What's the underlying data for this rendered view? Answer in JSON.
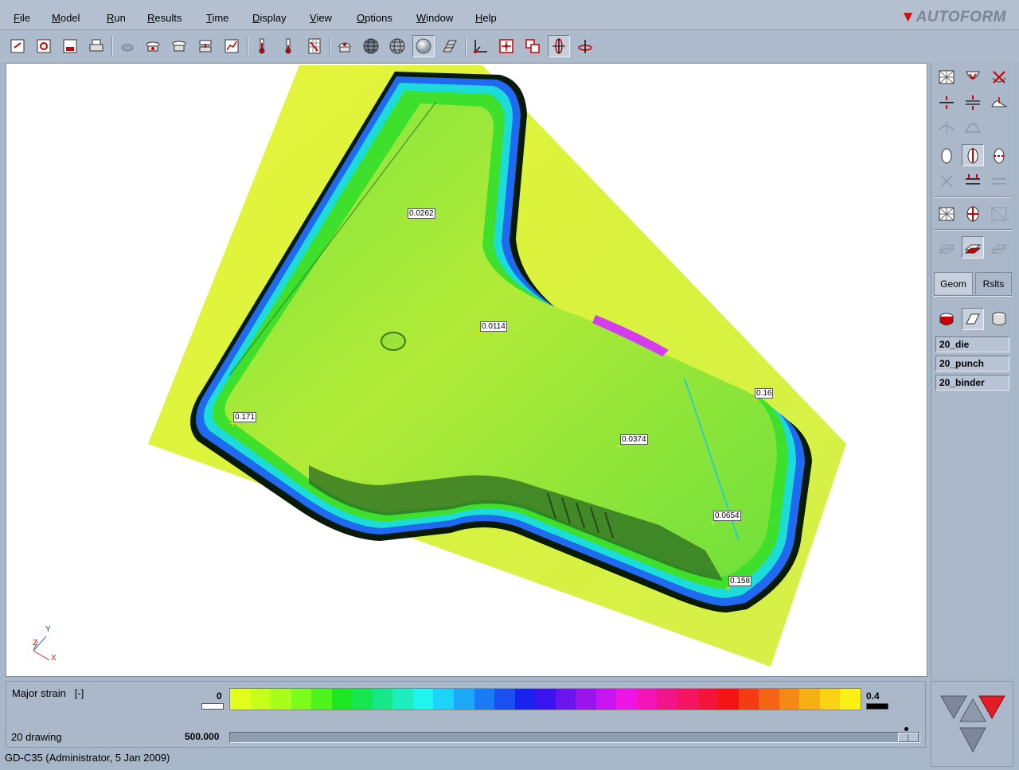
{
  "menu": {
    "items": [
      "File",
      "Model",
      "Run",
      "Results",
      "Time",
      "Display",
      "View",
      "Options",
      "Window",
      "Help"
    ],
    "brand": "AUTOFORM"
  },
  "toolbar": {
    "icons": [
      "open-file-icon",
      "reload-file-icon",
      "save-file-icon",
      "print-icon",
      "blank-icon",
      "tool-setup-icon",
      "blankholder-icon",
      "trim-icon",
      "stage-curve-icon",
      "thermometer-icon",
      "thermometer-alt-icon",
      "grid-chart-icon",
      "eye-view-icon",
      "wire-sphere-icon",
      "mesh-sphere-icon",
      "shaded-sphere-icon",
      "section-cut-icon",
      "axes-icon",
      "fit-view-icon",
      "copy-view-icon",
      "rotate-view-icon",
      "tilt-view-icon"
    ]
  },
  "viewport": {
    "probes": [
      {
        "value": "0.0262"
      },
      {
        "value": "0.0114"
      },
      {
        "value": "0.16"
      },
      {
        "value": "0.171"
      },
      {
        "value": "0.0374"
      },
      {
        "value": "0.0654"
      },
      {
        "value": "0.158"
      }
    ],
    "triad": {
      "x": "X",
      "y": "Y",
      "z": "Z"
    }
  },
  "right_panel": {
    "tabs": {
      "geometry": "Geom",
      "results": "Rslts"
    },
    "tools": [
      "20_die",
      "20_punch",
      "20_binder"
    ]
  },
  "legend": {
    "result_name": "Major strain",
    "unit": "[-]",
    "min": "0",
    "max": "0.4",
    "colors": [
      "#e0ff1a",
      "#c6ff1a",
      "#a8ff1a",
      "#7dfc1c",
      "#4ef51d",
      "#1de81f",
      "#14e650",
      "#16e88a",
      "#1ceec0",
      "#1ff5f0",
      "#1cd4f7",
      "#1aa8f7",
      "#1a7cf5",
      "#1a4ff2",
      "#1a22ef",
      "#3a14ee",
      "#6a14ee",
      "#9a14ee",
      "#c814ee",
      "#ee14e6",
      "#f414b8",
      "#f4148a",
      "#f41460",
      "#f4143a",
      "#f41414",
      "#f43c14",
      "#f46414",
      "#f48a14",
      "#f7b014",
      "#fad414",
      "#fcf014"
    ],
    "step_name": "20 drawing",
    "time_value": "500.000"
  },
  "status_bar": {
    "text": "GD-C35 (Administrator,  5 Jan 2009)"
  }
}
